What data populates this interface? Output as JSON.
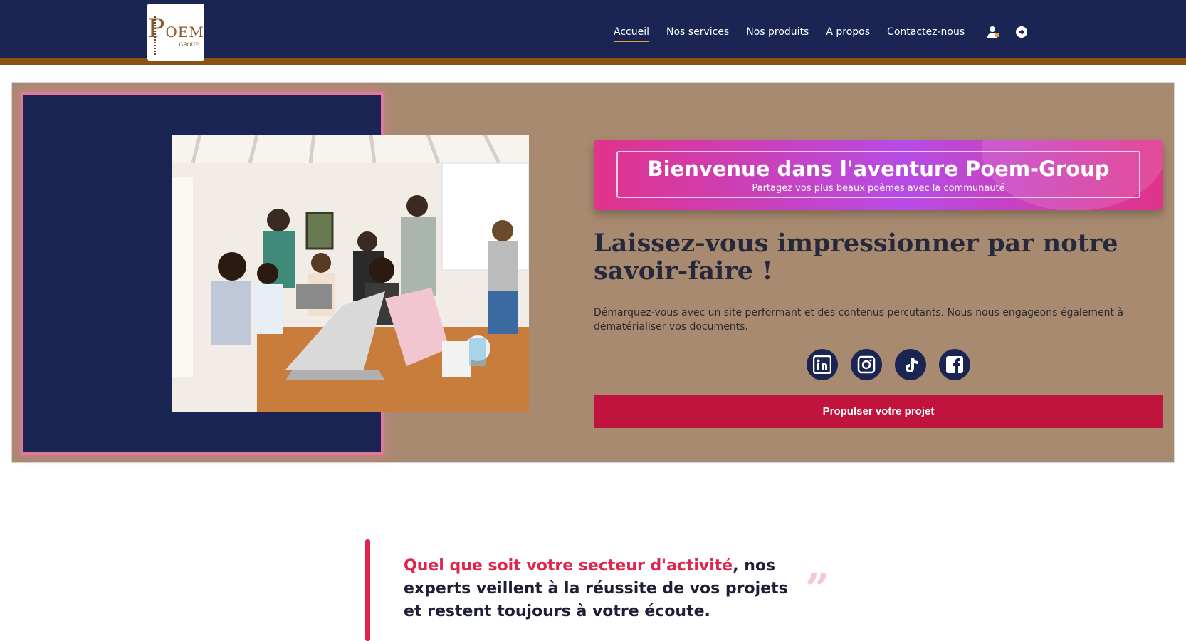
{
  "brand": {
    "logo_top": "P",
    "logo_rest": "OEM",
    "logo_sub": "GROUP"
  },
  "nav": {
    "items": [
      "Accueil",
      "Nos services",
      "Nos produits",
      "A propos",
      "Contactez-nous"
    ],
    "active": "Accueil",
    "icons": [
      "user-icon",
      "login-icon"
    ]
  },
  "hero": {
    "welcome_title": "Bienvenue dans l'aventure Poem-Group",
    "welcome_subtitle": "Partagez vos plus beaux poèmes avec la communauté",
    "headline": "Laissez-vous impressionner par notre savoir-faire !",
    "description": "Démarquez-vous avec un site performant et des contenus percutants. Nous nous engageons également à dématérialiser vos documents.",
    "socials": [
      "linkedin-icon",
      "instagram-icon",
      "tiktok-icon",
      "facebook-icon"
    ],
    "cta": "Propulser votre projet"
  },
  "quote": {
    "accent": "Quel que soit votre secteur d'activité",
    "rest": ", nos experts veillent à la réussite de vos projets et restent toujours à votre écoute.",
    "mark": "”"
  },
  "colors": {
    "header": "#1a2554",
    "header_stripe": "#8a5214",
    "hero_bg": "#a88a70",
    "accent_red": "#c0143c",
    "quote_accent": "#e0244e"
  }
}
